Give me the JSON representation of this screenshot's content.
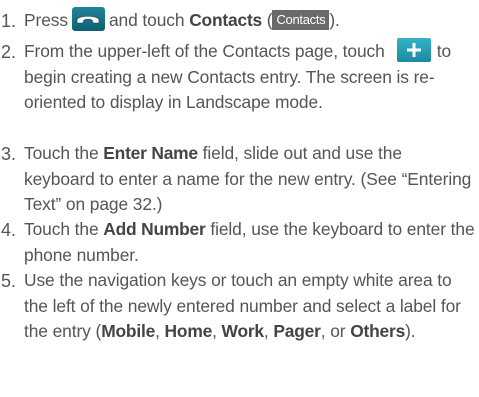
{
  "steps": [
    {
      "num": "1.",
      "a": "Press",
      "b": "and touch",
      "c": "Contacts",
      "d": " (",
      "chip": "Contacts",
      "e": ")."
    },
    {
      "num": "2.",
      "a": "From the upper-left of the Contacts page, touch",
      "b": "to begin creating a new Contacts entry. The screen is re-oriented to display in Landscape mode."
    },
    {
      "num": "3.",
      "a": "Touch the",
      "b": "Enter Name",
      "c": "field, slide out and use the keyboard to enter a name for the new entry. (See “Entering Text” on page 32.)"
    },
    {
      "num": "4.",
      "a": "Touch the",
      "b": "Add Number",
      "c": "field, use the keyboard to enter the phone number."
    },
    {
      "num": "5.",
      "a": "Use the navigation keys or touch an empty white area to the left of the newly entered number and select a label for the entry (",
      "o1": "Mobile",
      "sep1": ", ",
      "o2": "Home",
      "sep2": ", ",
      "o3": "Work",
      "sep3": ", ",
      "o4": "Pager",
      "sep4": ", or ",
      "o5": "Others",
      "end": ")."
    }
  ],
  "icons": {
    "phone": "phone-handset-icon",
    "plus": "plus-icon"
  },
  "colors": {
    "text": "#555555",
    "phone_bg": "#1a7488",
    "plus_bg": "#2aa3ba",
    "chip_bg": "#6a6a6a"
  }
}
